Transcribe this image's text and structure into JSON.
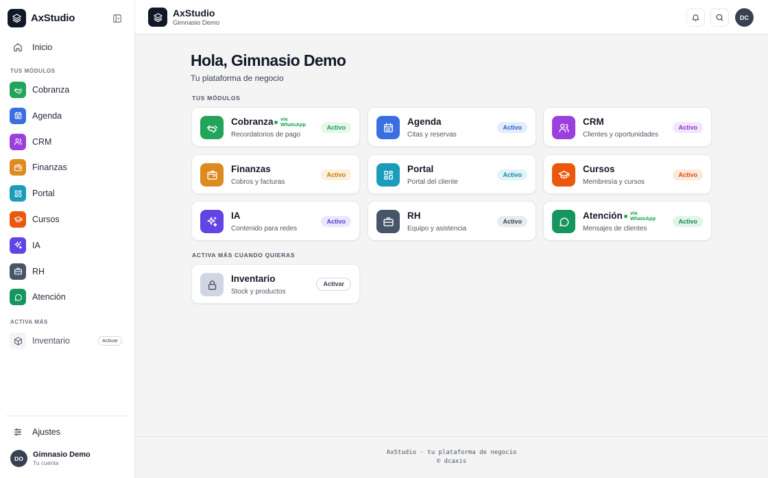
{
  "sidebar": {
    "brand": "AxStudio",
    "home_label": "Inicio",
    "modules_section": "TUS MÓDULOS",
    "modules": [
      {
        "label": "Cobranza",
        "color": "#22a55a",
        "icon": "handshake-icon"
      },
      {
        "label": "Agenda",
        "color": "#3b6fe0",
        "icon": "calendar-icon"
      },
      {
        "label": "CRM",
        "color": "#9b3fdd",
        "icon": "users-icon"
      },
      {
        "label": "Finanzas",
        "color": "#dd8a1f",
        "icon": "wallet-icon"
      },
      {
        "label": "Portal",
        "color": "#1b9cba",
        "icon": "grid-icon"
      },
      {
        "label": "Cursos",
        "color": "#ea580c",
        "icon": "graduation-cap-icon"
      },
      {
        "label": "IA",
        "color": "#6144e3",
        "icon": "sparkles-icon"
      },
      {
        "label": "RH",
        "color": "#475569",
        "icon": "briefcase-icon"
      },
      {
        "label": "Atención",
        "color": "#16965e",
        "icon": "chat-icon"
      }
    ],
    "more_section": "ACTIVA MÁS",
    "extra": {
      "label": "Inventario",
      "action": "Activar",
      "icon": "package-icon"
    },
    "settings_label": "Ajustes",
    "account": {
      "initials": "DO",
      "name": "Gimnasio Demo",
      "sub": "Tu cuenta"
    }
  },
  "header": {
    "title": "AxStudio",
    "subtitle": "Gimnasio Demo",
    "avatar_initials": "DC"
  },
  "main": {
    "greeting": "Hola, Gimnasio Demo",
    "subtitle": "Tu plataforma de negocio",
    "modules_section": "TUS MÓDULOS",
    "cards": [
      {
        "title": "Cobranza",
        "sub": "Recordatorios de pago",
        "badge": "Activo",
        "via": "via WhatsApp",
        "color": "#22a55a",
        "icon": "handshake-icon",
        "badge_bg": "#e7f6ec",
        "badge_fg": "#16a34a"
      },
      {
        "title": "Agenda",
        "sub": "Citas y reservas",
        "badge": "Activo",
        "color": "#3b6fe0",
        "icon": "calendar-icon",
        "badge_bg": "#e4ecfb",
        "badge_fg": "#2f5fd0"
      },
      {
        "title": "CRM",
        "sub": "Clientes y oportunidades",
        "badge": "Activo",
        "color": "#9b3fdd",
        "icon": "users-icon",
        "badge_bg": "#f1e6fb",
        "badge_fg": "#8a32c9"
      },
      {
        "title": "Finanzas",
        "sub": "Cobros y facturas",
        "badge": "Activo",
        "color": "#dd8a1f",
        "icon": "wallet-icon",
        "badge_bg": "#fcf0dc",
        "badge_fg": "#c47a10"
      },
      {
        "title": "Portal",
        "sub": "Portal del cliente",
        "badge": "Activo",
        "color": "#1b9cba",
        "icon": "grid-icon",
        "badge_bg": "#e0f3f8",
        "badge_fg": "#1589a6"
      },
      {
        "title": "Cursos",
        "sub": "Membresía y cursos",
        "badge": "Activo",
        "color": "#ea580c",
        "icon": "graduation-cap-icon",
        "badge_bg": "#fde9dc",
        "badge_fg": "#d2520b"
      },
      {
        "title": "IA",
        "sub": "Contenido para redes",
        "badge": "Activo",
        "color": "#6144e3",
        "icon": "sparkles-icon",
        "badge_bg": "#ebe7fc",
        "badge_fg": "#553bd0"
      },
      {
        "title": "RH",
        "sub": "Equipo y asistencia",
        "badge": "Activo",
        "color": "#475569",
        "icon": "briefcase-icon",
        "badge_bg": "#e9ebee",
        "badge_fg": "#334155"
      },
      {
        "title": "Atención",
        "sub": "Mensajes de clientes",
        "badge": "Activo",
        "via": "via WhatsApp",
        "color": "#16965e",
        "icon": "chat-icon",
        "badge_bg": "#e2f4ea",
        "badge_fg": "#138752"
      }
    ],
    "more_section": "ACTIVA MÁS CUANDO QUIERAS",
    "inactive_card": {
      "title": "Inventario",
      "sub": "Stock y productos",
      "action": "Activar",
      "color": "#cfd6e2",
      "icon": "lock-icon"
    }
  },
  "footer": {
    "line1": "AxStudio · tu plataforma de negocio",
    "line2": "© dcaxis"
  }
}
